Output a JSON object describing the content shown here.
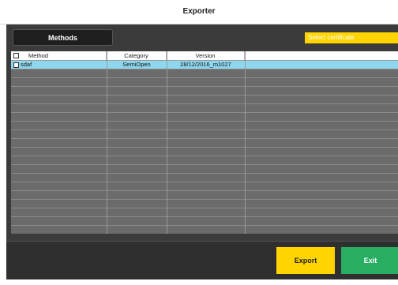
{
  "window": {
    "title": "Exporter"
  },
  "toolbar": {
    "methods_label": "Methods",
    "certificate_label": "Select certificate"
  },
  "table": {
    "headers": {
      "method": "Method",
      "category": "Category",
      "version": "Version"
    },
    "rows": [
      {
        "method": "sdaf",
        "category": "SemiOpen",
        "version": "28/12/2016_m1027",
        "selected": true
      }
    ]
  },
  "footer": {
    "export_label": "Export",
    "exit_label": "Exit"
  },
  "colors": {
    "accent_yellow": "#ffd400",
    "accent_green": "#27ae60",
    "selected_row": "#8fd7ee",
    "panel_dark": "#3b3b3b"
  }
}
